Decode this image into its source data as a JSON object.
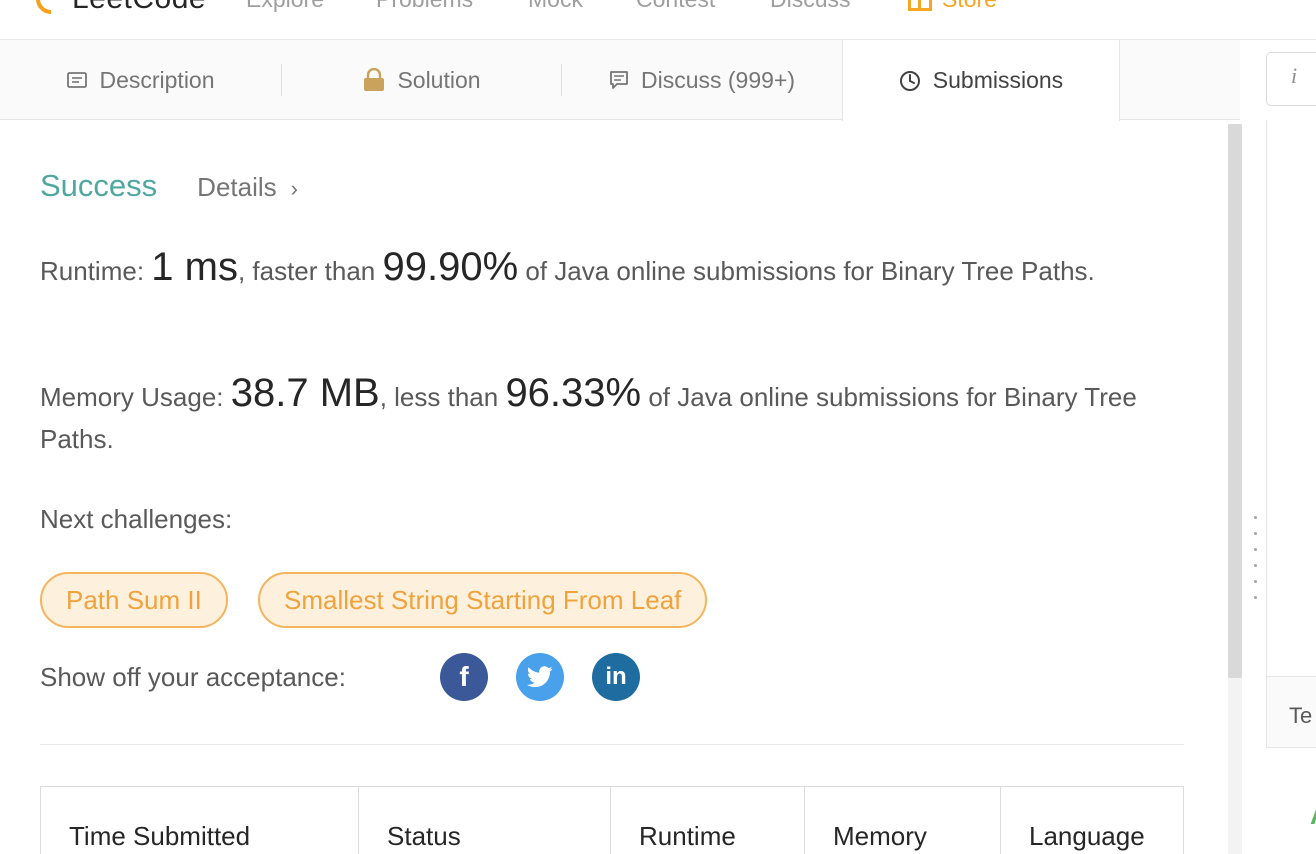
{
  "nav": {
    "logo_text": "LeetCode",
    "items": [
      "Explore",
      "Problems",
      "Mock",
      "Contest",
      "Discuss",
      "Store"
    ]
  },
  "tabs": [
    {
      "label": "Description",
      "icon": "description-icon"
    },
    {
      "label": "Solution",
      "icon": "lock-icon"
    },
    {
      "label": "Discuss (999+)",
      "icon": "comment-icon"
    },
    {
      "label": "Submissions",
      "icon": "clock-icon",
      "active": true
    }
  ],
  "result": {
    "status": "Success",
    "details": "Details",
    "runtime_label": "Runtime: ",
    "runtime_value": "1 ms",
    "runtime_mid": ", faster than ",
    "runtime_percent": "99.90%",
    "runtime_tail": " of Java online submissions for Binary Tree Paths.",
    "memory_label": "Memory Usage: ",
    "memory_value": "38.7 MB",
    "memory_mid": ", less than ",
    "memory_percent": "96.33%",
    "memory_tail": " of Java online submissions for Binary Tree Paths."
  },
  "next": {
    "label": "Next challenges:",
    "challenges": [
      "Path Sum II",
      "Smallest String Starting From Leaf"
    ]
  },
  "share": {
    "label": "Show off your acceptance:",
    "facebook": "f",
    "linkedin": "in"
  },
  "table": {
    "headers": [
      "Time Submitted",
      "Status",
      "Runtime",
      "Memory",
      "Language"
    ]
  },
  "right": {
    "info": "i",
    "test_tab": "Te",
    "green_char": "A"
  },
  "colors": {
    "success": "#4fa8a0",
    "chip_border": "#f5b45c",
    "chip_text": "#f0a23c",
    "facebook": "#3b5998",
    "twitter": "#49a1eb",
    "linkedin": "#1f6ca1"
  }
}
